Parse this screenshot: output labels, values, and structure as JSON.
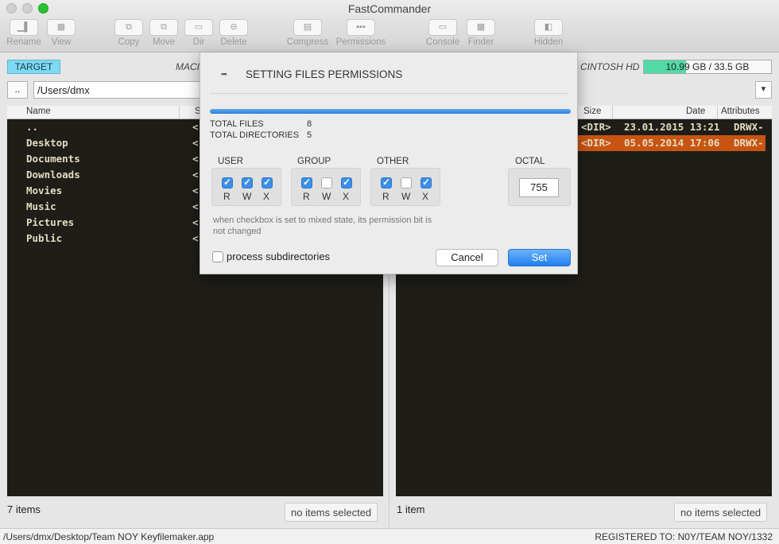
{
  "window": {
    "title": "FastCommander"
  },
  "toolbar": [
    {
      "label": "Rename",
      "icon": "rename-icon",
      "glyph": "▁▌"
    },
    {
      "label": "View",
      "icon": "view-icon",
      "glyph": "▦"
    },
    {
      "label": "Copy",
      "icon": "copy-icon",
      "glyph": "⧉"
    },
    {
      "label": "Move",
      "icon": "move-icon",
      "glyph": "⧉"
    },
    {
      "label": "Dir",
      "icon": "folder-icon",
      "glyph": "▭"
    },
    {
      "label": "Delete",
      "icon": "delete-icon",
      "glyph": "⊖"
    },
    {
      "label": "Compress",
      "icon": "compress-icon",
      "glyph": "▤"
    },
    {
      "label": "Permissions",
      "icon": "permissions-icon",
      "glyph": "▪▪▪"
    },
    {
      "label": "Console",
      "icon": "console-icon",
      "glyph": "▭"
    },
    {
      "label": "Finder",
      "icon": "finder-icon",
      "glyph": "▦"
    },
    {
      "label": "Hidden",
      "icon": "hidden-icon",
      "glyph": "◧"
    }
  ],
  "left_panel": {
    "badge": "TARGET",
    "volume": "MACI",
    "updir": "..",
    "path": "/Users/dmx",
    "columns": {
      "name": "Name",
      "size": "S"
    },
    "rows": [
      {
        "name": "..",
        "size": "<"
      },
      {
        "name": "Desktop",
        "size": "<"
      },
      {
        "name": "Documents",
        "size": "<"
      },
      {
        "name": "Downloads",
        "size": "<"
      },
      {
        "name": "Movies",
        "size": "<"
      },
      {
        "name": "Music",
        "size": "<"
      },
      {
        "name": "Pictures",
        "size": "<"
      },
      {
        "name": "Public",
        "size": "<"
      }
    ],
    "status": "7 items",
    "selection": "no items selected"
  },
  "right_panel": {
    "volume": "CINTOSH HD",
    "free_space": "10.99 GB / 33.5 GB",
    "used_fraction": 0.33,
    "columns": {
      "size": "Size",
      "date": "Date",
      "attributes": "Attributes"
    },
    "rows": [
      {
        "size": "<DIR>",
        "date": "23.01.2015 13:21",
        "attributes": "DRWX-",
        "selected": false
      },
      {
        "size": "<DIR>",
        "date": "05.05.2014 17:06",
        "attributes": "DRWX-",
        "selected": true
      }
    ],
    "status": "1 item",
    "selection": "no items selected"
  },
  "bottom": {
    "path": "/Users/dmx/Desktop/Team NOY Keyfilemaker.app",
    "registration": "REGISTERED TO: N0Y/TEAM NOY/1332"
  },
  "dialog": {
    "title": "SETTING FILES PERMISSIONS",
    "progress": 1.0,
    "total_files_label": "TOTAL FILES",
    "total_files": "8",
    "total_dirs_label": "TOTAL DIRECTORIES",
    "total_dirs": "5",
    "groups": [
      {
        "label": "USER",
        "r": true,
        "w": true,
        "x": true
      },
      {
        "label": "GROUP",
        "r": true,
        "w": false,
        "x": true
      },
      {
        "label": "OTHER",
        "r": true,
        "w": false,
        "x": true
      }
    ],
    "bits": [
      "R",
      "W",
      "X"
    ],
    "octal_label": "OCTAL",
    "octal": "755",
    "hint": "when checkbox is set to mixed state, its permission bit is not changed",
    "subdirs_label": "process subdirectories",
    "subdirs_checked": false,
    "cancel_label": "Cancel",
    "set_label": "Set"
  }
}
